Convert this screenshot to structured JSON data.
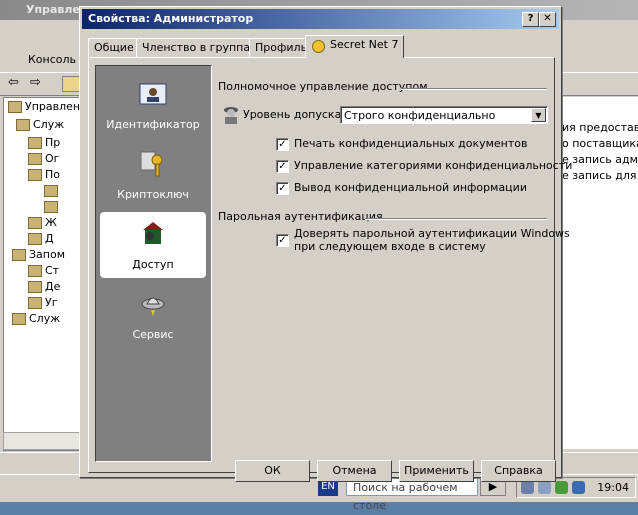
{
  "console": {
    "title": "Управлен",
    "menu_label": "Консоль",
    "tree_items": [
      "Управлен",
      "Служ",
      "Пр",
      "Ог",
      "По",
      "Ж",
      "Д",
      "Запом",
      "Ст",
      "Де",
      "Уг",
      "Служ"
    ],
    "right_items": [
      "ия предоставле",
      "о поставщика",
      "е запись адми",
      "е запись для ."
    ]
  },
  "taskbar": {
    "lang": "EN",
    "search_placeholder": "Поиск на рабочем столе",
    "clock": "19:04"
  },
  "dialog": {
    "title": "Свойства: Администратор",
    "help_btn": "?",
    "close_btn": "✕",
    "tabs": [
      "Общие",
      "Членство в группах",
      "Профиль",
      "Secret Net 7"
    ],
    "nav": [
      "Идентификатор",
      "Криптоключ",
      "Доступ",
      "Сервис"
    ],
    "access_section": "Полномочное управление доступом",
    "level_label": "Уровень допуска:",
    "level_value": "Строго конфиденциально",
    "checks": [
      "Печать конфиденциальных документов",
      "Управление категориями конфиденциальности",
      "Вывод конфиденциальной информации"
    ],
    "password_section": "Парольная аутентификация",
    "password_check_1": "Доверять парольной аутентификации Windows",
    "password_check_2": "при следующем входе в систему",
    "buttons": {
      "ok": "ОК",
      "cancel": "Отмена",
      "apply": "Применить",
      "help": "Справка"
    }
  }
}
